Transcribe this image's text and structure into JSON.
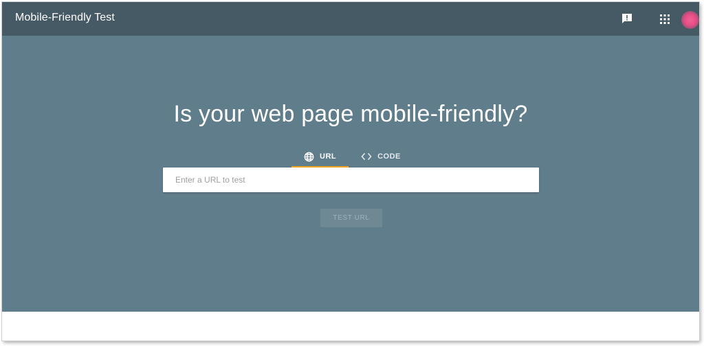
{
  "header": {
    "title": "Mobile-Friendly Test",
    "feedback_icon": "feedback-icon",
    "apps_icon": "apps-grid-icon",
    "avatar_color": "#e84d86"
  },
  "main": {
    "headline": "Is your web page mobile-friendly?",
    "tabs": [
      {
        "label": "URL",
        "icon": "globe-icon",
        "active": true
      },
      {
        "label": "CODE",
        "icon": "code-icon",
        "active": false
      }
    ],
    "url_input": {
      "placeholder": "Enter a URL to test",
      "value": ""
    },
    "test_button": {
      "label": "TEST URL",
      "enabled": false
    }
  },
  "colors": {
    "topbar": "#455a64",
    "hero": "#607d8b",
    "tab_indicator": "#f5a623"
  }
}
